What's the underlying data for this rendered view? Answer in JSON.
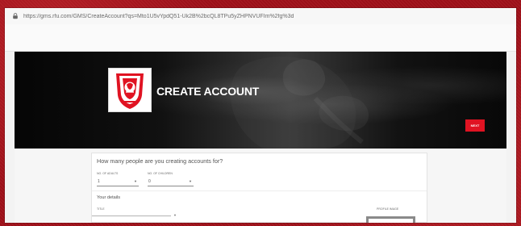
{
  "browser": {
    "url": "https://gms.rfu.com/GMS/CreateAccount?qs=Mto1U5vYpdQ51-Uk2B%2bcQL8TPu5yZHPNVUFIm%2fg%3d"
  },
  "hero": {
    "title": "CREATE ACCOUNT",
    "next_label": "NEXT"
  },
  "form": {
    "question": "How many people are you creating accounts for?",
    "adults_label": "NO. OF ADULTS",
    "adults_value": "1",
    "children_label": "NO. OF CHILDREN",
    "children_value": "0",
    "section_title": "Your details",
    "title_label": "TITLE",
    "profile_image_label": "PROFILE IMAGE"
  },
  "icons": {
    "address": "lock-icon",
    "logo": "rugby-club-crest-icon",
    "chevron": "chevron-down-icon"
  },
  "colors": {
    "accent": "#e01322",
    "hero_background": "#111111",
    "frame_background": "#a1111a"
  }
}
